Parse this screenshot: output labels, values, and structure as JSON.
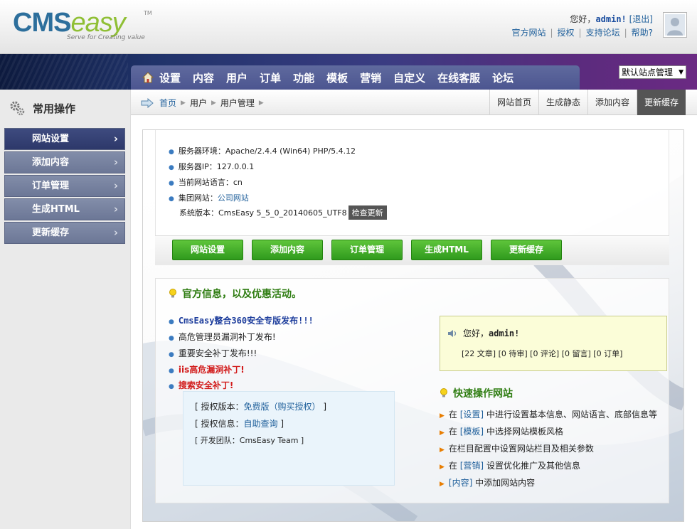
{
  "brand": {
    "logo_cms": "CMS",
    "logo_easy": "easy",
    "logo_tm": "TM",
    "tagline": "Serve for Creating value"
  },
  "user": {
    "greeting": "您好，",
    "name": "admin!",
    "logout": "[退出]",
    "links": [
      "官方网站",
      "授权",
      "支持论坛",
      "帮助?"
    ]
  },
  "nav": {
    "items": [
      "设置",
      "内容",
      "用户",
      "订单",
      "功能",
      "模板",
      "营销",
      "自定义",
      "在线客服",
      "论坛"
    ],
    "site_select": "默认站点管理"
  },
  "sidebar": {
    "title": "常用操作",
    "items": [
      "网站设置",
      "添加内容",
      "订单管理",
      "生成HTML",
      "更新缓存"
    ]
  },
  "breadcrumb": {
    "items": [
      "首页",
      "用户",
      "用户管理"
    ]
  },
  "quick_tabs": [
    "网站首页",
    "生成静态",
    "添加内容",
    "更新缓存"
  ],
  "server_info": {
    "env_label": "服务器环境：",
    "env_value": "Apache/2.4.4 (Win64) PHP/5.4.12",
    "ip_label": "服务器IP：",
    "ip_value": "127.0.0.1",
    "lang_label": "当前网站语言：",
    "lang_value": "cn",
    "group_label": "集团网站：",
    "group_value": "公司网站",
    "version_label": "系统版本：",
    "version_value": "CmsEasy 5_5_0_20140605_UTF8",
    "check_update": "检查更新"
  },
  "green_buttons": [
    "网站设置",
    "添加内容",
    "订单管理",
    "生成HTML",
    "更新缓存"
  ],
  "news": {
    "title": "官方信息，以及优惠活动。",
    "items": [
      "CmsEasy整合360安全专版发布!!!",
      "高危管理员漏洞补丁发布!",
      "重要安全补丁发布!!!",
      "iis高危漏洞补丁!",
      "搜索安全补丁!"
    ]
  },
  "license": {
    "version_label": "[ 授权版本：",
    "version_value": "免费版（购买授权）",
    "version_end": " ]",
    "info_label": "[ 授权信息：",
    "info_value": "自助查询",
    "info_end": " ]",
    "team": "[ 开发团队：CmsEasy Team ]"
  },
  "welcome": {
    "greeting": "您好，",
    "name": "admin!",
    "stats": "[22 文章] [0 待审] [0 评论] [0 留言] [0 订单]"
  },
  "quick_ops": {
    "title": "快速操作网站",
    "items": [
      {
        "pre": "在 ",
        "link": "[设置]",
        "post": " 中进行设置基本信息、网站语言、底部信息等"
      },
      {
        "pre": "在 ",
        "link": "[模板]",
        "post": " 中选择网站模板风格"
      },
      {
        "pre": "",
        "link": "",
        "post": "在栏目配置中设置网站栏目及相关参数"
      },
      {
        "pre": "在 ",
        "link": "[营销]",
        "post": " 设置优化推广及其他信息"
      },
      {
        "pre": "",
        "link": "[内容]",
        "post": " 中添加网站内容"
      }
    ]
  }
}
